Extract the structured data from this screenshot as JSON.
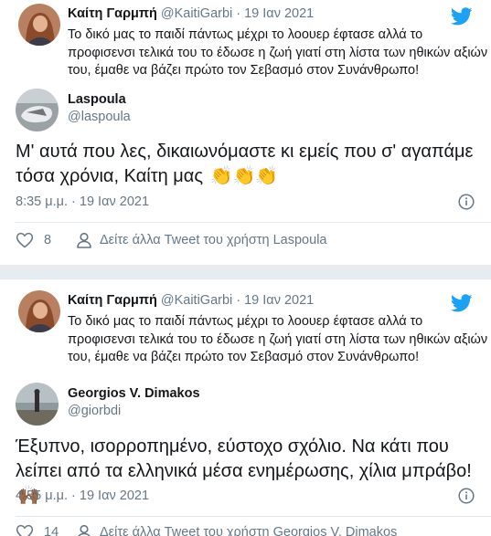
{
  "tweets": [
    {
      "quoted": {
        "name": "Καίτη Γαρμπή",
        "handle": "@KaitiGarbi",
        "date": "· 19 Ιαν 2021",
        "text": "Το δικό μας το παιδί πάντως μέχρι το λοουερ έφτασε αλλά το προφισενσι τελικά του το έδωσε η ζωή γιατί στη λίστα των ηθικών αξιών του, έμαθε να βάζει πρώτο τον Σεβασμό στον Συνάνθρωπο!"
      },
      "reply": {
        "name": "Laspoula",
        "handle": "@laspoula",
        "text": "Μ' αυτά που λες, δικαιωνόμαστε κι εμείς που σ' αγαπάμε τόσα χρόνια, Καίτη μας",
        "emoji": "👏👏👏",
        "timestamp": "8:35 μ.μ. · 19 Ιαν 2021",
        "likes": "8",
        "see_more": "Δείτε άλλα Tweet του χρήστη Laspoula"
      }
    },
    {
      "quoted": {
        "name": "Καίτη Γαρμπή",
        "handle": "@KaitiGarbi",
        "date": "· 19 Ιαν 2021",
        "text": "Το δικό μας το παιδί πάντως μέχρι το λοουερ έφτασε αλλά το προφισενσι τελικά του το έδωσε η ζωή γιατί στη λίστα των ηθικών αξιών του, έμαθε να βάζει πρώτο τον Σεβασμό στον Συνάνθρωπο!"
      },
      "reply": {
        "name": "Georgios V. Dimakos",
        "handle": "@giorbdi",
        "text": "Έξυπνο, ισορροπημένο, εύστοχο σχόλιο. Να κάτι που λείπει από τα ελληνικά μέσα ενημέρωσης, χίλια μπράβο!",
        "emoji": "🙌🏾",
        "timestamp": "4:55 μ.μ. · 19 Ιαν 2021",
        "likes": "14",
        "see_more": "Δείτε άλλα Tweet του χρήστη Georgios V. Dimakos"
      }
    }
  ],
  "colors": {
    "twitter_blue": "#1da1f2",
    "muted_text": "#657786",
    "divider": "#e1e8ed",
    "page_background": "#e6ecf0"
  },
  "icons": [
    "twitter-bird-icon",
    "info-icon",
    "heart-icon",
    "person-icon",
    "clapping-hands-emoji",
    "raising-hands-emoji"
  ]
}
